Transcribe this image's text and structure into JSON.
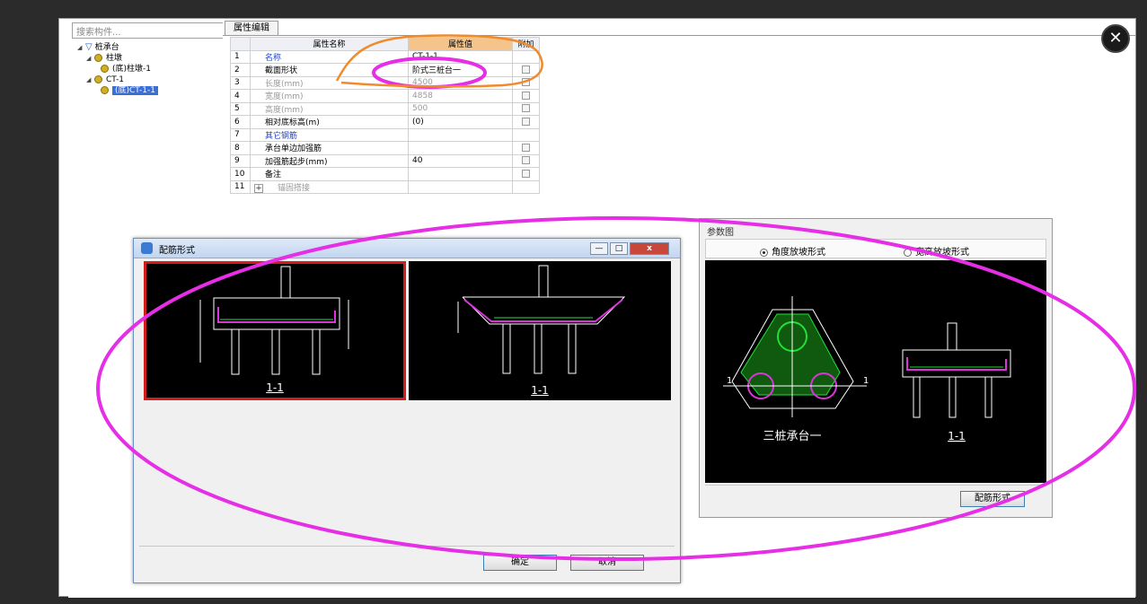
{
  "search": {
    "placeholder": "搜索构件..."
  },
  "tree": [
    {
      "label": "桩承台",
      "level": 0
    },
    {
      "label": "柱墩",
      "level": 1
    },
    {
      "label": "(底)柱墩-1",
      "level": 2
    },
    {
      "label": "CT-1",
      "level": 1
    },
    {
      "label": "(底)CT-1-1",
      "level": 2,
      "selected": true
    }
  ],
  "props": {
    "tab": "属性编辑",
    "col_name": "属性名称",
    "col_value": "属性值",
    "col_extra": "附加",
    "rows": [
      {
        "no": "1",
        "name": "名称",
        "value": "CT-1-1",
        "style": "blue",
        "check": false
      },
      {
        "no": "2",
        "name": "截面形状",
        "value": "阶式三桩台一",
        "style": "",
        "check": true
      },
      {
        "no": "3",
        "name": "长度(mm)",
        "value": "4500",
        "style": "gray",
        "check": true
      },
      {
        "no": "4",
        "name": "宽度(mm)",
        "value": "4858",
        "style": "gray",
        "check": true
      },
      {
        "no": "5",
        "name": "高度(mm)",
        "value": "500",
        "style": "gray",
        "check": true
      },
      {
        "no": "6",
        "name": "相对底标高(m)",
        "value": "(0)",
        "style": "",
        "check": true
      },
      {
        "no": "7",
        "name": "其它钢筋",
        "value": "",
        "style": "blue",
        "check": false
      },
      {
        "no": "8",
        "name": "承台单边加强筋",
        "value": "",
        "style": "",
        "check": true
      },
      {
        "no": "9",
        "name": "加强筋起步(mm)",
        "value": "40",
        "style": "",
        "check": true
      },
      {
        "no": "10",
        "name": "备注",
        "value": "",
        "style": "",
        "check": true
      },
      {
        "no": "11",
        "name": "锚固搭接",
        "value": "",
        "style": "gray",
        "check": false,
        "expand": "+"
      }
    ]
  },
  "dialog": {
    "title": "配筋形式",
    "min": "—",
    "max": "□",
    "close": "x",
    "thumb1_caption": "1-1",
    "thumb2_caption": "1-1",
    "ok": "确定",
    "cancel": "取消"
  },
  "param": {
    "header": "参数图",
    "radio1": "角度放坡形式",
    "radio2": "宽高放坡形式",
    "plan_label": "三桩承台一",
    "section_label": "1-1",
    "button": "配筋形式"
  },
  "colors": {
    "annotation_magenta": "#e62ee6",
    "annotation_orange": "#f08a2a",
    "drawing_green": "#22e03a",
    "drawing_magenta": "#d836d8"
  }
}
